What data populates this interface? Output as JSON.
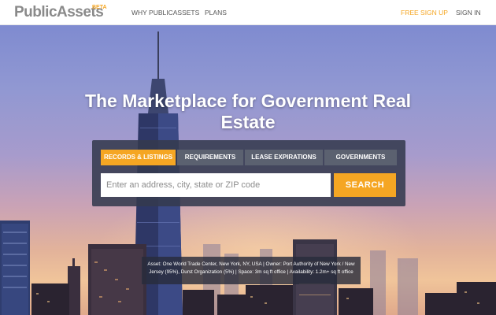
{
  "header": {
    "logo": {
      "part1": "Public",
      "part2": "Assets",
      "badge": "BETA"
    },
    "nav": {
      "why": "WHY PUBLICASSETS",
      "plans": "PLANS",
      "signup": "FREE SIGN UP",
      "signin": "SIGN IN"
    }
  },
  "hero": {
    "title": "The Marketplace for Government Real Estate"
  },
  "search": {
    "tabs": [
      {
        "label": "RECORDS & LISTINGS",
        "active": true
      },
      {
        "label": "REQUIREMENTS",
        "active": false
      },
      {
        "label": "LEASE EXPIRATIONS",
        "active": false
      },
      {
        "label": "GOVERNMENTS",
        "active": false
      }
    ],
    "placeholder": "Enter an address, city, state or ZIP code",
    "button": "SEARCH"
  },
  "caption": {
    "text": "Asset: One World Trade Center, New York, NY, USA | Owner: Port Authority of New York / New Jersey (95%), Durst Organization (5%) | Space: 3m sq ft office | Availability: 1.2m+ sq ft office"
  },
  "colors": {
    "accent": "#f5a623",
    "panel": "#343a4e",
    "tab_inactive": "#5b6170",
    "logo_gray": "#8a8a8a"
  }
}
